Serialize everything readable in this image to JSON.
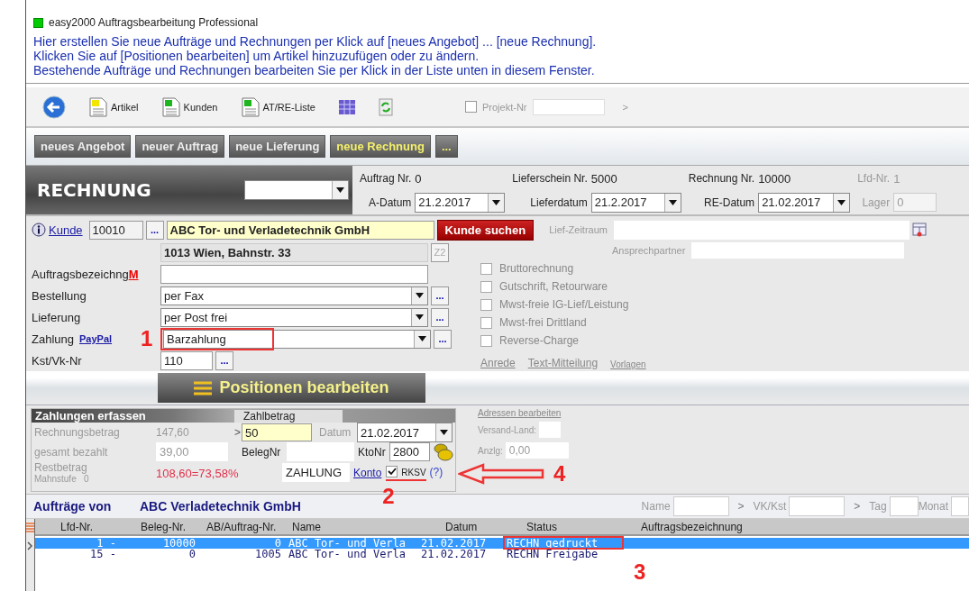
{
  "window": {
    "title": "easy2000 Auftragsbearbeitung Professional"
  },
  "instructions": [
    "Hier erstellen Sie neue Aufträge und Rechnungen per Klick auf [neues Angebot] ... [neue Rechnung].",
    "Klicken Sie auf [Positionen bearbeiten] um Artikel hinzuzufügen oder zu ändern.",
    "Bestehende Aufträge und Rechnungen bearbeiten Sie per Klick in der Liste unten in diesem Fenster."
  ],
  "toolbar": {
    "items": [
      {
        "kind": "back"
      },
      {
        "kind": "doc",
        "label": "Artikel",
        "color": "#f2e600"
      },
      {
        "kind": "doc",
        "label": "Kunden",
        "color": "#1fb51f"
      },
      {
        "kind": "doc",
        "label": "AT/RE-Liste",
        "color": "#1fb51f"
      },
      {
        "kind": "grid"
      },
      {
        "kind": "refresh"
      }
    ],
    "project": {
      "label": "Projekt-Nr",
      "checked": false,
      "arrow": ">"
    }
  },
  "actions": [
    {
      "label": "neues Angebot",
      "selected": false
    },
    {
      "label": "neuer Auftrag",
      "selected": false
    },
    {
      "label": "neue Lieferung",
      "selected": false
    },
    {
      "label": "neue Rechnung",
      "selected": true
    },
    {
      "label": "...",
      "selected": true
    }
  ],
  "document": {
    "type": "RECHNUNG",
    "groups": [
      {
        "top_label": "Auftrag Nr.",
        "top_value": "0",
        "bottom_label": "A-Datum",
        "date": "21.2.2017",
        "disabled": false
      },
      {
        "top_label": "Lieferschein Nr.",
        "top_value": "5000",
        "bottom_label": "Lieferdatum",
        "date": "21.2.2017",
        "disabled": false
      },
      {
        "top_label": "Rechnung Nr.",
        "top_value": "10000",
        "bottom_label": "RE-Datum",
        "date": "21.02.2017",
        "disabled": false
      },
      {
        "top_label": "Lfd-Nr.",
        "top_value": "1",
        "bottom_label": "Lager",
        "date": "0",
        "disabled": true
      }
    ]
  },
  "customer": {
    "link": "Kunde",
    "number": "10010",
    "more": "...",
    "name": "ABC Tor- und Verladetechnik GmbH",
    "address": "1013 Wien, Bahnstr. 33",
    "z2": "Z2",
    "search": "Kunde suchen",
    "period_label": "Lief-Zeitraum",
    "contact_label": "Ansprechpartner"
  },
  "fields": [
    {
      "kind": "text",
      "label": "Auftragsbezeichng",
      "mark": "M"
    },
    {
      "kind": "select",
      "label": "Bestellung",
      "value": "per Fax",
      "more": "..."
    },
    {
      "kind": "select",
      "label": "Lieferung",
      "value": "per Post frei",
      "more": "..."
    },
    {
      "kind": "select",
      "label": "Zahlung",
      "link": "PayPal",
      "value": "Barzahlung",
      "more": "..."
    },
    {
      "kind": "short",
      "label": "Kst/Vk-Nr",
      "value": "110",
      "more": "..."
    }
  ],
  "options": [
    {
      "label": "Bruttorechnung",
      "checked": false
    },
    {
      "label": "Gutschrift, Retourware",
      "checked": false
    },
    {
      "label": "Mwst-freie IG-Lief/Leistung",
      "checked": false
    },
    {
      "label": "Mwst-frei Drittland",
      "checked": false
    },
    {
      "label": "Reverse-Charge",
      "checked": false
    }
  ],
  "links": [
    {
      "label": "Anrede",
      "small": false
    },
    {
      "label": "Text-Mitteilung",
      "small": false
    },
    {
      "label": "Vorlagen",
      "small": true
    }
  ],
  "positions_button": "Positionen bearbeiten",
  "payment": {
    "title": "Zahlungen erfassen",
    "amount_label": "Zahlbetrag",
    "invoice_label": "Rechnungsbetrag",
    "invoice_value": "147,60",
    "gt": ">",
    "amount": "50",
    "date_label": "Datum",
    "date": "21.02.2017",
    "paid_label": "gesamt bezahlt",
    "paid_value": "39,00",
    "receipt_label": "BelegNr",
    "account_label": "KtoNr",
    "account": "2800",
    "rest_label": "Restbetrag",
    "dunning": "Mahnstufe   0",
    "rest_value": "108,60=73,58%",
    "text": "ZAHLUNG",
    "konto": "Konto",
    "rksv": {
      "label": "RKSV",
      "checked": true
    },
    "help": "(?)"
  },
  "side": {
    "link": "Adressen bearbeiten",
    "country_label": "Versand-Land:",
    "deposit_label": "Anzlg:",
    "deposit": "0,00"
  },
  "orders": {
    "title": "Aufträge von",
    "company": "ABC Verladetechnik GmbH",
    "filters": [
      {
        "label": "Name"
      },
      {
        "label": "VK/Kst",
        "prefix": ">"
      },
      {
        "label": "Tag",
        "prefix": ">"
      },
      {
        "label": "Monat"
      }
    ],
    "columns": [
      "Lfd-Nr.",
      "Beleg-Nr.",
      "AB/Auftrag-Nr.",
      "Name",
      "Datum",
      "Status",
      "Auftragsbezeichnung"
    ],
    "rows": [
      {
        "selected": true,
        "lfd": "1 -",
        "beleg": "10000",
        "ab": "0",
        "name": "ABC Tor- und Verla",
        "datum": "21.02.2017",
        "status": "RECHN gedruckt"
      },
      {
        "selected": false,
        "lfd": "15 -",
        "beleg": "0",
        "ab": "1005",
        "name": "ABC Tor- und Verla",
        "datum": "21.02.2017",
        "status": "RECHN Freigabe"
      }
    ]
  },
  "annotations": [
    {
      "label": "1"
    },
    {
      "label": "2"
    },
    {
      "label": "3"
    },
    {
      "label": "4"
    }
  ]
}
